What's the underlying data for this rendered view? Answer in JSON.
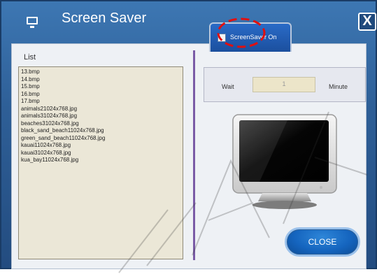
{
  "window": {
    "title": "Screen Saver",
    "close_glyph": "X",
    "icon": "monitor-icon"
  },
  "tab": {
    "label": "ScreenSaver On",
    "checked": false
  },
  "list": {
    "label": "List",
    "items": [
      "13.bmp",
      "14.bmp",
      "15.bmp",
      "16.bmp",
      "17.bmp",
      "animals21024x768.jpg",
      "animals31024x768.jpg",
      "beaches31024x768.jpg",
      "black_sand_beach11024x768.jpg",
      "green_sand_beach11024x768.jpg",
      "kauai11024x768.jpg",
      "kauai31024x768.jpg",
      "kua_bay11024x768.jpg"
    ]
  },
  "wait": {
    "label": "Wait",
    "value": "1",
    "unit": "Minute"
  },
  "preview": {
    "icon": "monitor-preview-icon"
  },
  "close_button": {
    "label": "CLOSE"
  },
  "colors": {
    "title_bar": "#2e5f97",
    "panel": "#eef1f5",
    "list_bg": "#ebe7d7",
    "accent_button": "#1565bf",
    "annotation_red": "#e01010",
    "divider": "#7a5ba6"
  }
}
